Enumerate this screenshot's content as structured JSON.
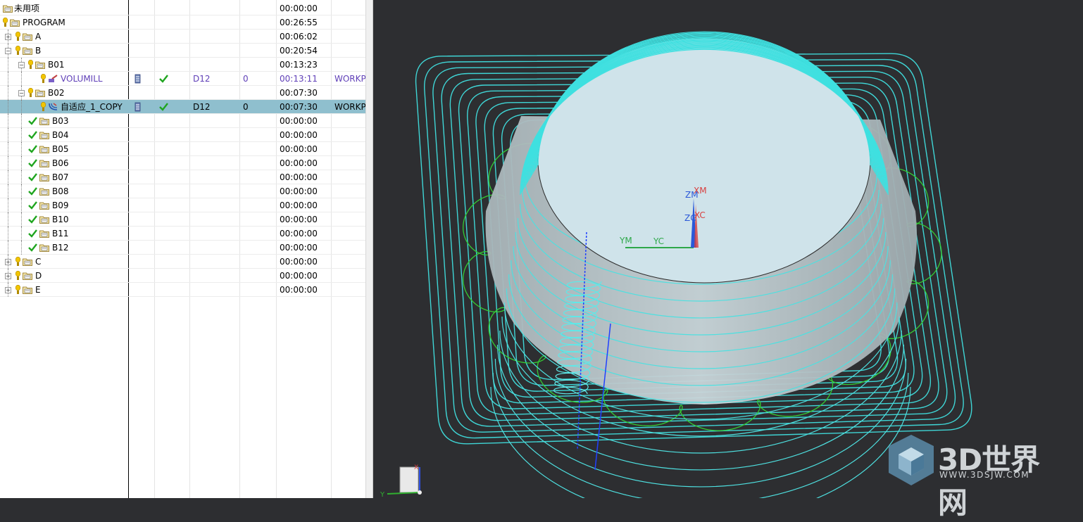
{
  "operation_navigator": {
    "rows": [
      {
        "name": "未用项",
        "time": "00:00:00"
      },
      {
        "name": "PROGRAM",
        "time": "00:26:55"
      },
      {
        "name": "A",
        "time": "00:06:02"
      },
      {
        "name": "B",
        "time": "00:20:54"
      },
      {
        "name": "B01",
        "time": "00:13:23"
      },
      {
        "name": "VOLUMILL",
        "tool": "D12",
        "num": "0",
        "time": "00:13:11",
        "geom": "WORKP"
      },
      {
        "name": "B02",
        "time": "00:07:30"
      },
      {
        "name": "自适应_1_COPY",
        "tool": "D12",
        "num": "0",
        "time": "00:07:30",
        "geom": "WORKP"
      },
      {
        "name": "B03",
        "time": "00:00:00"
      },
      {
        "name": "B04",
        "time": "00:00:00"
      },
      {
        "name": "B05",
        "time": "00:00:00"
      },
      {
        "name": "B06",
        "time": "00:00:00"
      },
      {
        "name": "B07",
        "time": "00:00:00"
      },
      {
        "name": "B08",
        "time": "00:00:00"
      },
      {
        "name": "B09",
        "time": "00:00:00"
      },
      {
        "name": "B10",
        "time": "00:00:00"
      },
      {
        "name": "B11",
        "time": "00:00:00"
      },
      {
        "name": "B12",
        "time": "00:00:00"
      },
      {
        "name": "C",
        "time": "00:00:00"
      },
      {
        "name": "D",
        "time": "00:00:00"
      },
      {
        "name": "E",
        "time": "00:00:00"
      }
    ]
  },
  "viewport": {
    "axis_labels": {
      "zm": "ZM",
      "xm": "XM",
      "zc": "ZC",
      "xc": "XC",
      "ym": "YM",
      "yc": "YC"
    },
    "triad": {
      "y": "Y",
      "x": "X"
    },
    "colors": {
      "background": "#2d2e31",
      "toolpath_cyan": "#3fd6d6",
      "toolpath_green": "#33cc33",
      "part": "#cfe3ea"
    }
  },
  "watermark": {
    "brand": "3D世界网",
    "url": "WWW.3DSJW.COM"
  }
}
